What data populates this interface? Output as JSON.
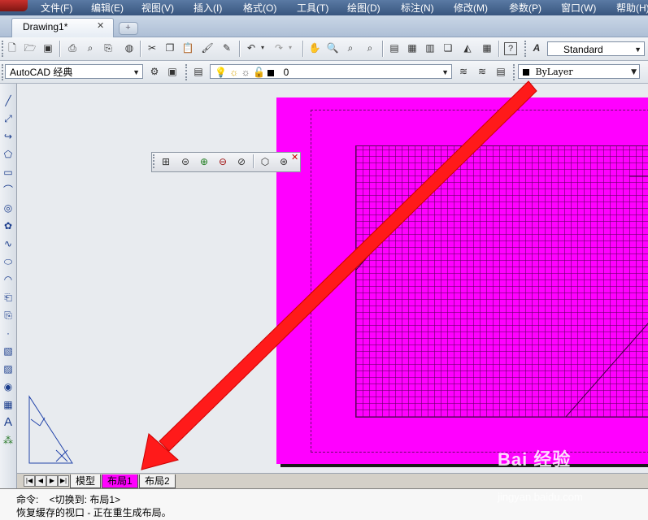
{
  "menu": {
    "items": [
      "文件(F)",
      "编辑(E)",
      "视图(V)",
      "插入(I)",
      "格式(O)",
      "工具(T)",
      "绘图(D)",
      "标注(N)",
      "修改(M)",
      "参数(P)",
      "窗口(W)",
      "帮助(H)"
    ]
  },
  "doc_tab": {
    "title": "Drawing1*",
    "close": "✕"
  },
  "toolbar_standard": {
    "text_style_value": "Standard"
  },
  "toolbar_layers": {
    "workspace_value": "AutoCAD 经典",
    "layer_value": "0",
    "color_value": "ByLayer"
  },
  "layout_tabs": {
    "tabs": [
      "模型",
      "布局1",
      "布局2"
    ],
    "active": "布局1",
    "active_color": "#ff00ff"
  },
  "command": {
    "line1": "命令:    <切换到: 布局1>",
    "line2": "恢复缓存的视口 - 正在重生成布局。"
  },
  "watermark": {
    "main": "Bai 经验",
    "sub": "jingyan.baidu.com"
  },
  "colors": {
    "paper": "#ff00ff",
    "arrow": "#ff0000",
    "menubar": "#4a6690"
  },
  "icons": {
    "standard_toolbar": [
      "new-icon",
      "open-icon",
      "save-icon",
      "plot-icon",
      "plot-preview-icon",
      "publish-icon",
      "3d-dwf-icon",
      "cut-icon",
      "copy-icon",
      "paste-icon",
      "match-properties-icon",
      "block-editor-icon",
      "undo-icon",
      "redo-icon",
      "pan-icon",
      "zoom-realtime-icon",
      "zoom-window-icon",
      "zoom-previous-icon",
      "properties-icon",
      "design-center-icon",
      "tool-palettes-icon",
      "sheet-set-icon",
      "markup-icon",
      "calculator-icon",
      "help-icon",
      "text-style-icon"
    ],
    "left_draw_toolbar": [
      "line-icon",
      "construction-line-icon",
      "polyline-icon",
      "polygon-icon",
      "rectangle-icon",
      "arc-icon",
      "circle-icon",
      "revision-cloud-icon",
      "spline-icon",
      "ellipse-icon",
      "ellipse-arc-icon",
      "insert-block-icon",
      "make-block-icon",
      "point-icon",
      "hatch-icon",
      "gradient-icon",
      "region-icon",
      "table-icon",
      "multiline-text-icon",
      "add-selected-icon"
    ],
    "float_toolbar": [
      "single-viewport-icon",
      "viewport-icon",
      "viewport-add-icon",
      "viewport-remove-icon",
      "viewport-clip-icon",
      "viewport-scale-icon",
      "viewport-clear-icon"
    ]
  }
}
